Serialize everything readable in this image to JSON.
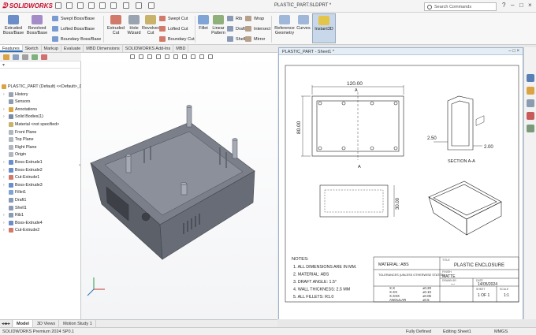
{
  "app": {
    "brand": "SOLIDWORKS",
    "document_title": "PLASTIC_PART.SLDPRT *",
    "search_placeholder": "Search Commands"
  },
  "ribbon": {
    "extruded_boss": "Extruded Boss/Base",
    "revolved_boss": "Revolved Boss/Base",
    "swept_boss": "Swept Boss/Base",
    "lofted_boss": "Lofted Boss/Base",
    "boundary_boss": "Boundary Boss/Base",
    "extruded_cut": "Extruded Cut",
    "hole_wizard": "Hole Wizard",
    "revolved_cut": "Revolved Cut",
    "swept_cut": "Swept Cut",
    "lofted_cut": "Lofted Cut",
    "boundary_cut": "Boundary Cut",
    "fillet": "Fillet",
    "linear_pattern": "Linear Pattern",
    "rib": "Rib",
    "draft": "Draft",
    "shell": "Shell",
    "wrap": "Wrap",
    "intersect": "Intersect",
    "mirror": "Mirror",
    "reference_geometry": "Reference Geometry",
    "curves": "Curves",
    "instant3d": "Instant3D"
  },
  "cm_tabs": [
    "Features",
    "Sketch",
    "Markup",
    "Evaluate",
    "MBD Dimensions",
    "SOLIDWORKS Add-Ins",
    "MBD"
  ],
  "tree": {
    "root": "PLASTIC_PART (Default) <<Default>_Displa",
    "items": [
      {
        "label": "History",
        "expand": "›"
      },
      {
        "label": "Sensors",
        "expand": ""
      },
      {
        "label": "Annotations",
        "expand": "›"
      },
      {
        "label": "Solid Bodies(1)",
        "expand": "›"
      },
      {
        "label": "Material <not specified>",
        "expand": ""
      },
      {
        "label": "Front Plane",
        "expand": ""
      },
      {
        "label": "Top Plane",
        "expand": ""
      },
      {
        "label": "Right Plane",
        "expand": ""
      },
      {
        "label": "Origin",
        "expand": ""
      },
      {
        "label": "Boss-Extrude1",
        "expand": "›"
      },
      {
        "label": "Boss-Extrude2",
        "expand": "›"
      },
      {
        "label": "Cut-Extrude1",
        "expand": "›"
      },
      {
        "label": "Boss-Extrude3",
        "expand": "›"
      },
      {
        "label": "Fillet1",
        "expand": ""
      },
      {
        "label": "Draft1",
        "expand": ""
      },
      {
        "label": "Shell1",
        "expand": ""
      },
      {
        "label": "Rib1",
        "expand": "›"
      },
      {
        "label": "Boss-Extrude4",
        "expand": "›"
      },
      {
        "label": "Cut-Extrude2",
        "expand": "›"
      }
    ]
  },
  "bottom_tabs": [
    "Model",
    "3D Views",
    "Motion Study 1"
  ],
  "status": {
    "left": "SOLIDWORKS Premium 2024 SP0.1",
    "fully": "Fully Defined",
    "editing": "Editing Sheet1",
    "units": "MMGS"
  },
  "drawing": {
    "window_title": "PLASTIC_PART - Sheet1 *",
    "dim_width": "120.00",
    "dim_height": "80.00",
    "dim_depth": "30.00",
    "dim_250": "2.50",
    "dim_200": "2.00",
    "section_label": "A",
    "section_view": "SECTION A-A",
    "notes": {
      "title": "NOTES:",
      "lines": [
        "1. ALL DIMENSIONS ARE IN MM.",
        "2. MATERIAL: ABS",
        "3. DRAFT ANGLE: 1.5°",
        "4. WALL THICKNESS: 2.5 MM",
        "5. ALL FILLETS: R1.0"
      ]
    },
    "title_block": {
      "material": "MATERIAL: ABS",
      "title_caption": "TITLE",
      "title": "PLASTIC ENCLOSURE",
      "tolerances": "TOLERANCES (UNLESS OTHERWISE STATED)",
      "finish_caption": "FINISH",
      "finish": "MATTE",
      "drawn_caption": "DRAWN BY",
      "drawn": "---",
      "date_caption": "DATE",
      "date": "14/05/2024",
      "tol_rows": [
        {
          "k": "X.X",
          "v": "±0.20"
        },
        {
          "k": "X.XX",
          "v": "±0.10"
        },
        {
          "k": "X.XXX",
          "v": "±0.05"
        },
        {
          "k": "ANGULAR",
          "v": "±0.5"
        }
      ],
      "sheet_caption": "SHEET",
      "sheet": "1 OF 1",
      "scale_caption": "SCALE",
      "scale": "1:1"
    }
  },
  "colors": {
    "accent": "#2a6ebb",
    "brand": "#c8102e",
    "model": "#6f7480",
    "drawing_line": "#222222"
  }
}
